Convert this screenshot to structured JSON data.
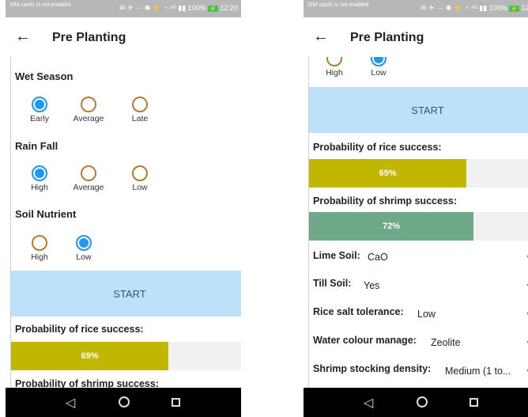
{
  "status": {
    "sim": "SIM card1 is not enabled",
    "icons": "✉ ✈ ··· ✱ ⚡ ◔ ⁴ᴳ ▮▮ 100%",
    "battery": "⚡",
    "time": "12:20"
  },
  "app": {
    "back_icon": "arrow-left-icon",
    "title": "Pre Planting"
  },
  "wet_season": {
    "title": "Wet Season",
    "options": [
      "Early",
      "Average",
      "Late"
    ],
    "selected": "Early"
  },
  "rain_fall": {
    "title": "Rain Fall",
    "options": [
      "High",
      "Average",
      "Low"
    ],
    "selected": "High"
  },
  "soil_nutrient": {
    "title": "Soil Nutrient",
    "options": [
      "High",
      "Low"
    ],
    "selected": "Low"
  },
  "start_label": "START",
  "rice": {
    "title": "Probability of rice success:",
    "value_label": "69%",
    "fraction": 0.69,
    "color": "#c2b700"
  },
  "shrimp": {
    "title": "Probability of shrimp success:",
    "value_label": "72%",
    "fraction": 0.72,
    "color": "#6ea98a"
  },
  "fields": [
    {
      "label": "Lime Soil:",
      "value": "CaO"
    },
    {
      "label": "Till Soil:",
      "value": "Yes"
    },
    {
      "label": "Rice salt tolerance:",
      "value": "Low"
    },
    {
      "label": "Water colour manage:",
      "value": "Zeolite"
    },
    {
      "label": "Shrimp stocking density:",
      "value": "Medium (1 to..."
    }
  ],
  "nav": {
    "back": "◁",
    "home": "home-icon",
    "recents": "recents-icon"
  }
}
